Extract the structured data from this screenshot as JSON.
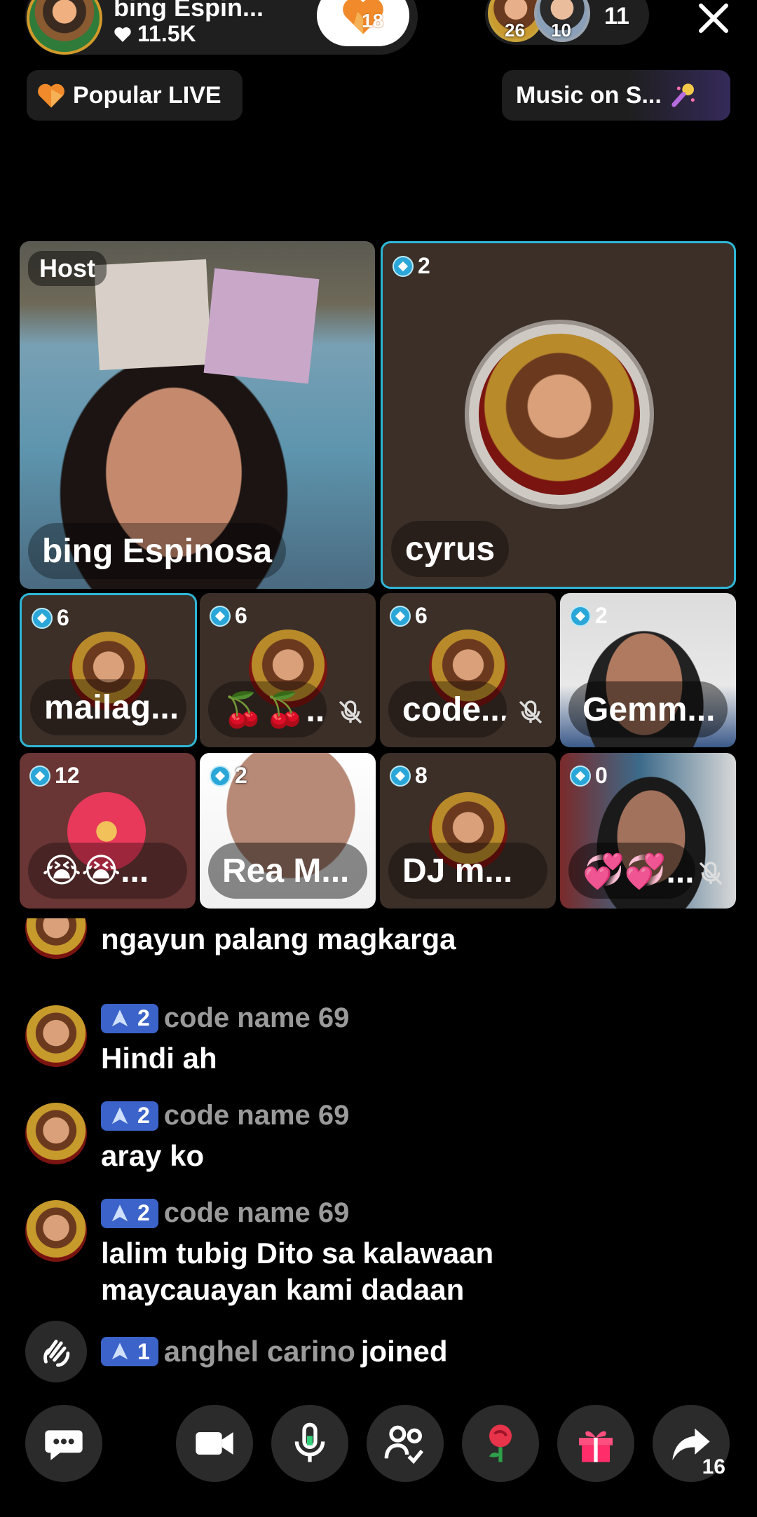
{
  "header": {
    "host_name": "bing Espin...",
    "host_likes": "11.5K",
    "fan_count": "18",
    "viewer_badges": [
      "26",
      "10"
    ],
    "viewer_count": "11"
  },
  "chips": {
    "popular": "Popular LIVE",
    "music": "Music on S..."
  },
  "grid": {
    "host_badge": "Host",
    "host_name": "bing Espinosa",
    "tiles": [
      {
        "level": "2",
        "name": "cyrus"
      },
      {
        "level": "6",
        "name": "mailag..."
      },
      {
        "level": "6",
        "name": "🍒🍒..."
      },
      {
        "level": "6",
        "name": "code..."
      },
      {
        "level": "2",
        "name": "Gemm..."
      },
      {
        "level": "12",
        "name": "😭😭..."
      },
      {
        "level": "2",
        "name": "Rea M..."
      },
      {
        "level": "8",
        "name": "DJ  m..."
      },
      {
        "level": "0",
        "name": "💞💞..."
      }
    ]
  },
  "chat": {
    "partial_message": "ngayun palang magkarga",
    "messages": [
      {
        "level": "2",
        "user": "code name 69",
        "text": "Hindi ah"
      },
      {
        "level": "2",
        "user": "code name 69",
        "text": "aray ko"
      },
      {
        "level": "2",
        "user": "code name 69",
        "text": "lalim tubig Dito sa kalawaan",
        "text2": "maycauayan kami dadaan"
      }
    ],
    "join": {
      "level": "1",
      "user": "anghel carino",
      "action": "joined"
    }
  },
  "bottom": {
    "share_count": "16"
  },
  "colors": {
    "background": "#000000",
    "accent_border": "#2fb6d6",
    "level_badge": "#3c63c9",
    "tile_bg": "#3b2f28",
    "muted_text": "#9a9a9a"
  },
  "icons": [
    "heart-icon",
    "fan-heart-icon",
    "close-icon",
    "popular-heart-icon",
    "music-mic-icon",
    "level-gem-icon",
    "mute-mic-icon",
    "wave-hand-icon",
    "chat-icon",
    "camera-icon",
    "mic-icon",
    "guests-icon",
    "rose-icon",
    "gift-icon",
    "share-icon",
    "level-arrow-icon"
  ]
}
